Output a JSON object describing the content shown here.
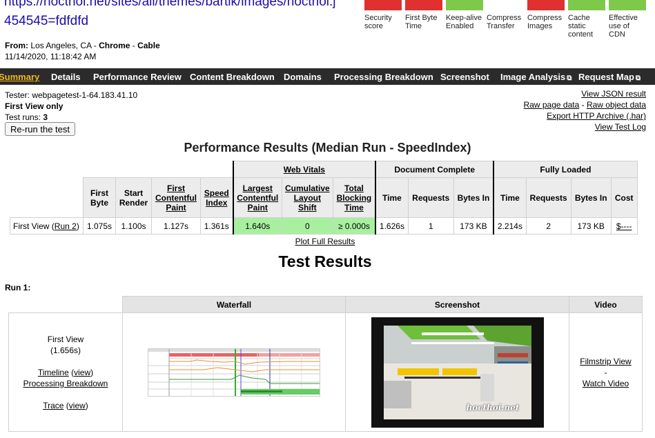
{
  "header": {
    "url_line1": "https://hocthoi.net/sites/all/themes/bartik/images/hocthoi.j",
    "url_line2": "454545=fdfdfd",
    "from_label": "From:",
    "from_location": "Los Angeles, CA - ",
    "browser": "Chrome",
    "separator": " - ",
    "connection": "Cable",
    "timestamp": "11/14/2020, 11:18:42 AM"
  },
  "grades": [
    {
      "label": "Security score",
      "color": "#e03030"
    },
    {
      "label": "First Byte Time",
      "color": "#e03030"
    },
    {
      "label": "Keep-alive Enabled",
      "color": "#7ec94a"
    },
    {
      "label": "Compress Transfer",
      "color": "#ffffff"
    },
    {
      "label": "Compress Images",
      "color": "#e03030"
    },
    {
      "label": "Cache static content",
      "color": "#7ec94a"
    },
    {
      "label": "Effective use of CDN",
      "color": "#7ec94a"
    }
  ],
  "nav": {
    "summary": "Summary",
    "details": "Details",
    "performance_review": "Performance Review",
    "content_breakdown": "Content Breakdown",
    "domains": "Domains",
    "processing_breakdown": "Processing Breakdown",
    "screenshot": "Screenshot",
    "image_analysis": "Image Analysis",
    "request_map": "Request Map",
    "external_icon": "⧉"
  },
  "test_info": {
    "tester": "Tester: webpagetest-1-64.183.41.10",
    "view": "First View only",
    "runs_label": "Test runs: ",
    "runs_value": "3",
    "rerun_button": "Re-run the test"
  },
  "right_links": {
    "view_json": "View JSON result",
    "raw_page": "Raw page data",
    "dash": " - ",
    "raw_object": "Raw object data",
    "export_har": "Export HTTP Archive (.har)",
    "view_log": "View Test Log"
  },
  "performance": {
    "title": "Performance Results (Median Run - SpeedIndex)",
    "groups": {
      "web_vitals": "Web Vitals",
      "document_complete": "Document Complete",
      "fully_loaded": "Fully Loaded"
    },
    "headers": {
      "first_byte": "First Byte",
      "start_render": "Start Render",
      "fcp": "First Contentful Paint",
      "speed_index": "Speed Index",
      "lcp": "Largest Contentful Paint",
      "cls": "Cumulative Layout Shift",
      "tbt": "Total Blocking Time",
      "time": "Time",
      "requests": "Requests",
      "bytes_in": "Bytes In",
      "cost": "Cost"
    },
    "row": {
      "label_prefix": "First View (",
      "run_link": "Run 2",
      "label_suffix": ")",
      "first_byte": "1.075s",
      "start_render": "1.100s",
      "fcp": "1.127s",
      "speed_index": "1.361s",
      "lcp": "1.640s",
      "cls": "0",
      "tbt": "≥ 0.000s",
      "dc_time": "1.626s",
      "dc_requests": "1",
      "dc_bytes": "173 KB",
      "fl_time": "2.214s",
      "fl_requests": "2",
      "fl_bytes": "173 KB",
      "cost": "$----"
    },
    "plot_link": "Plot Full Results"
  },
  "test_results": {
    "title": "Test Results",
    "run_label": "Run 1:",
    "headers": {
      "waterfall": "Waterfall",
      "screenshot": "Screenshot",
      "video": "Video"
    },
    "first_view": "First View",
    "first_view_time": "(1.656s)",
    "timeline": "Timeline",
    "view": "view",
    "processing_breakdown": "Processing Breakdown",
    "trace": "Trace",
    "filmstrip": "Filmstrip View",
    "dash": "-",
    "watch_video": "Watch Video",
    "screenshot_watermark": "hocthoi.net"
  }
}
